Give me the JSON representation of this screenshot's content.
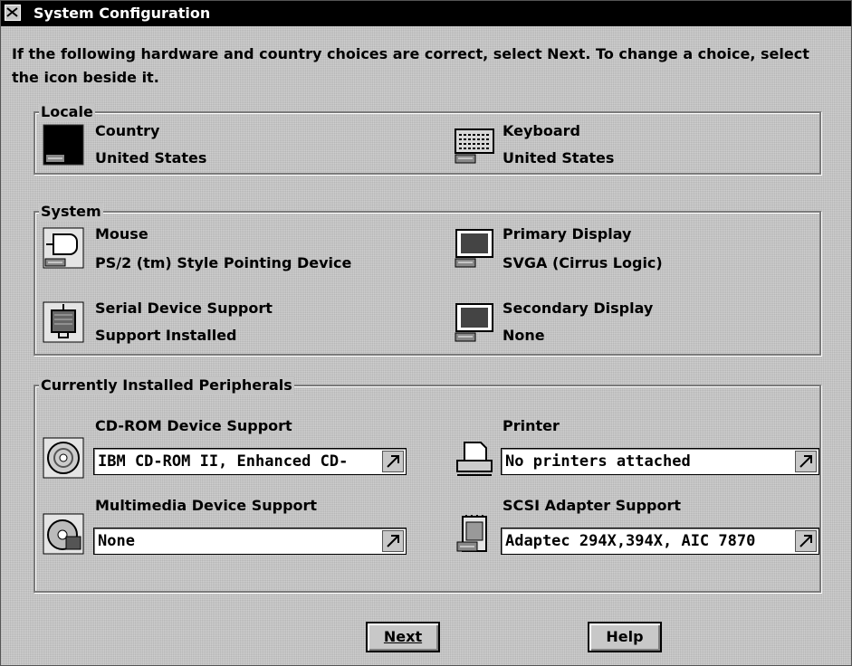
{
  "window": {
    "title": "System Configuration"
  },
  "instructions": "If the following hardware and country choices are correct, select Next. To change a choice, select the icon beside it.",
  "locale": {
    "legend": "Locale",
    "country": {
      "label": "Country",
      "value": "United States",
      "icon": "globe-icon"
    },
    "keyboard": {
      "label": "Keyboard",
      "value": "United States",
      "icon": "keyboard-icon"
    }
  },
  "system": {
    "legend": "System",
    "mouse": {
      "label": "Mouse",
      "value": "PS/2 (tm) Style Pointing Device",
      "icon": "mouse-icon"
    },
    "primary_display": {
      "label": "Primary Display",
      "value": "SVGA (Cirrus Logic)",
      "icon": "monitor-icon"
    },
    "serial": {
      "label": "Serial Device Support",
      "value": "Support Installed",
      "icon": "serial-device-icon"
    },
    "secondary_display": {
      "label": "Secondary Display",
      "value": "None",
      "icon": "monitor-icon"
    }
  },
  "peripherals": {
    "legend": "Currently Installed Peripherals",
    "cdrom": {
      "label": "CD-ROM Device Support",
      "value": "IBM CD-ROM II, Enhanced CD-",
      "icon": "cd-icon"
    },
    "printer": {
      "label": "Printer",
      "value": "No printers attached",
      "icon": "printer-icon"
    },
    "multimedia": {
      "label": "Multimedia Device Support",
      "value": "None",
      "icon": "multimedia-icon"
    },
    "scsi": {
      "label": "SCSI Adapter Support",
      "value": "Adaptec 294X,394X, AIC 7870",
      "icon": "scsi-adapter-icon"
    }
  },
  "buttons": {
    "next": "Next",
    "help": "Help"
  }
}
